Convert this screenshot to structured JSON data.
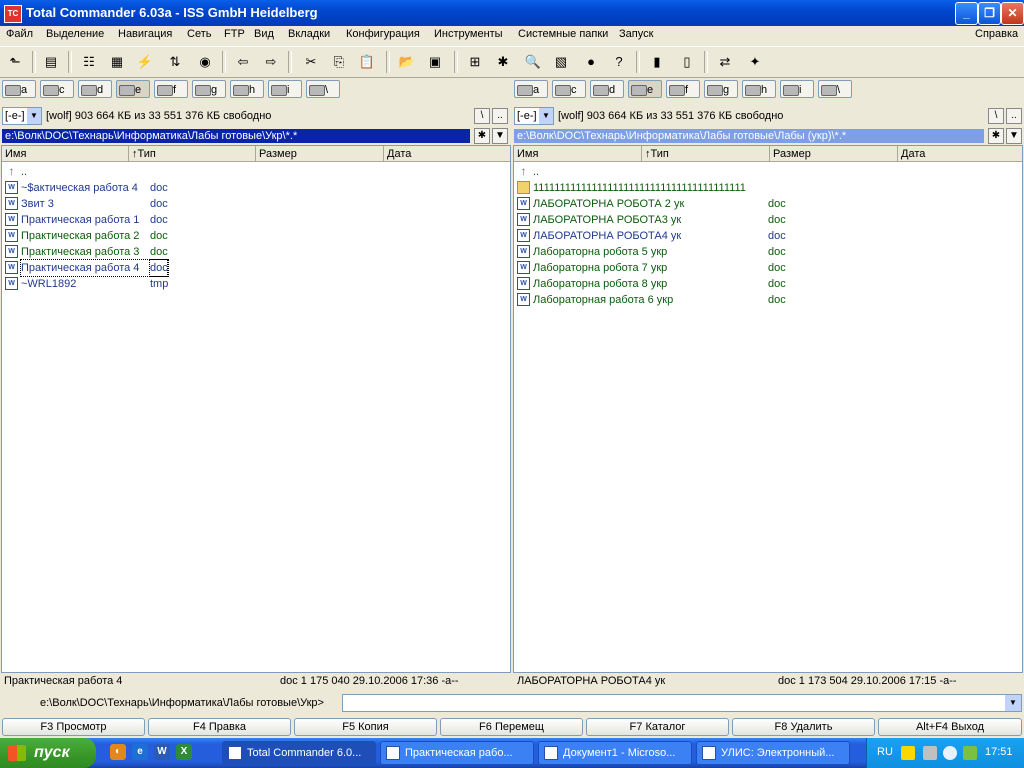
{
  "window": {
    "title": "Total Commander 6.03a - ISS GmbH Heidelberg",
    "icon_text": "TC"
  },
  "menu": [
    "Файл",
    "Выделение",
    "Навигация",
    "Сеть",
    "FTP",
    "Вид",
    "Вкладки",
    "Конфигурация",
    "Инструменты",
    "Системные папки",
    "Запуск"
  ],
  "menu_help": "Справка",
  "drives": [
    "a",
    "c",
    "d",
    "e",
    "f",
    "g",
    "h",
    "i",
    "\\"
  ],
  "left": {
    "drive_select": "[-e-]",
    "free": "[wolf]  903 664 КБ из 33 551 376 КБ свободно",
    "path": "e:\\Волк\\DOC\\Технарь\\Информатика\\Лабы готовые\\Укр\\*.*",
    "columns": [
      "Имя",
      "↑Тип",
      "Размер",
      "Дата"
    ],
    "files": [
      {
        "name": "..",
        "ext": "",
        "icon": "up",
        "color": "green"
      },
      {
        "name": "~$актическая работа 4",
        "ext": "doc",
        "icon": "doc",
        "color": "blue"
      },
      {
        "name": "Звит 3",
        "ext": "doc",
        "icon": "doc",
        "color": "blue"
      },
      {
        "name": "Практическая работа 1",
        "ext": "doc",
        "icon": "doc",
        "color": "blue"
      },
      {
        "name": "Практическая работа  2",
        "ext": "doc",
        "icon": "doc",
        "color": "green"
      },
      {
        "name": "Практическая работа  3",
        "ext": "doc",
        "icon": "doc",
        "color": "green"
      },
      {
        "name": "Практическая работа 4",
        "ext": "doc",
        "icon": "doc",
        "color": "blue"
      },
      {
        "name": "~WRL1892",
        "ext": "tmp",
        "icon": "doc",
        "color": "blue"
      }
    ],
    "status_name": "Практическая работа 4",
    "status_info": "doc  1 175 040  29.10.2006 17:36 -a--"
  },
  "right": {
    "drive_select": "[-e-]",
    "free": "[wolf]  903 664 КБ из 33 551 376 КБ свободно",
    "path": "e:\\Волк\\DOC\\Технарь\\Информатика\\Лабы готовые\\Лабы (укр)\\*.*",
    "columns": [
      "Имя",
      "↑Тип",
      "Размер",
      "Дата"
    ],
    "files": [
      {
        "name": "..",
        "ext": "",
        "icon": "up",
        "color": "green"
      },
      {
        "name": "1111111111111111111111111111111111111111",
        "ext": "",
        "icon": "folder",
        "color": "green"
      },
      {
        "name": "ЛАБОРАТОРНА РОБОТА  2 ук",
        "ext": "doc",
        "icon": "doc",
        "color": "green"
      },
      {
        "name": "ЛАБОРАТОРНА РОБОТА3 ук",
        "ext": "doc",
        "icon": "doc",
        "color": "green"
      },
      {
        "name": "ЛАБОРАТОРНА РОБОТА4 ук",
        "ext": "doc",
        "icon": "doc",
        "color": "blue"
      },
      {
        "name": "Лабораторна робота 5 укр",
        "ext": "doc",
        "icon": "doc",
        "color": "green"
      },
      {
        "name": "Лабораторна робота 7 укр",
        "ext": "doc",
        "icon": "doc",
        "color": "green"
      },
      {
        "name": "Лабораторна робота 8 укр",
        "ext": "doc",
        "icon": "doc",
        "color": "green"
      },
      {
        "name": "Лабораторная работа 6 укр",
        "ext": "doc",
        "icon": "doc",
        "color": "green"
      }
    ],
    "status_name": "ЛАБОРАТОРНА РОБОТА4 ук",
    "status_info": "doc  1 173 504  29.10.2006 17:15 -a--"
  },
  "cmdline": {
    "label": "e:\\Волк\\DOC\\Технарь\\Информатика\\Лабы готовые\\Укр>"
  },
  "fkeys": [
    "F3 Просмотр",
    "F4 Правка",
    "F5 Копия",
    "F6 Перемещ",
    "F7 Каталог",
    "F8 Удалить",
    "Alt+F4 Выход"
  ],
  "taskbar": {
    "start": "пуск",
    "tasks": [
      "Total Commander 6.0...",
      "Практическая рабо...",
      "Документ1 - Microso...",
      "УЛИС: Электронный..."
    ],
    "lang": "RU",
    "clock": "17:51"
  },
  "colors": {
    "path_active": "#0A24A8",
    "path_inactive": "#7E9EE5",
    "blue_text": "#1f3a8a",
    "green_text": "#0d5a0d"
  }
}
